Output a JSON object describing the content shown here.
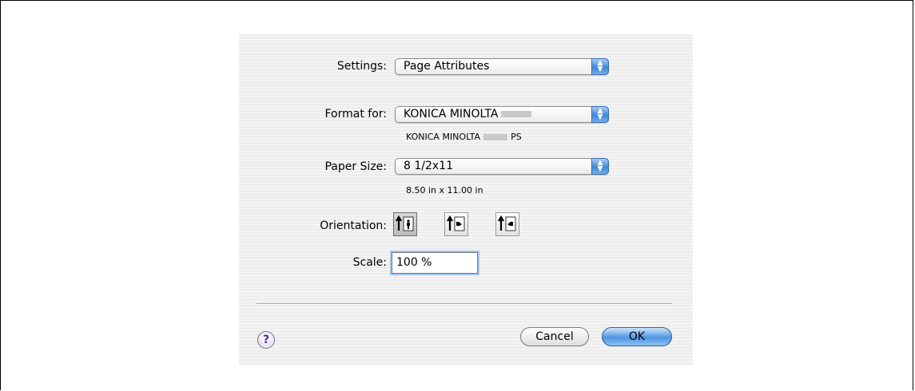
{
  "dialog": {
    "settings_label": "Settings:",
    "settings_value": "Page Attributes",
    "format_label": "Format for:",
    "format_value": "KONICA MINOLTA",
    "format_sub_prefix": "KONICA MINOLTA",
    "format_sub_suffix": "PS",
    "paper_label": "Paper Size:",
    "paper_value": "8 1/2x11",
    "paper_dims": "8.50 in x 11.00 in",
    "orientation_label": "Orientation:",
    "scale_label": "Scale:",
    "scale_value": "100 %",
    "help_glyph": "?",
    "cancel_label": "Cancel",
    "ok_label": "OK",
    "orientation_options": [
      "portrait",
      "landscape-left",
      "landscape-right"
    ],
    "orientation_selected": "portrait"
  }
}
